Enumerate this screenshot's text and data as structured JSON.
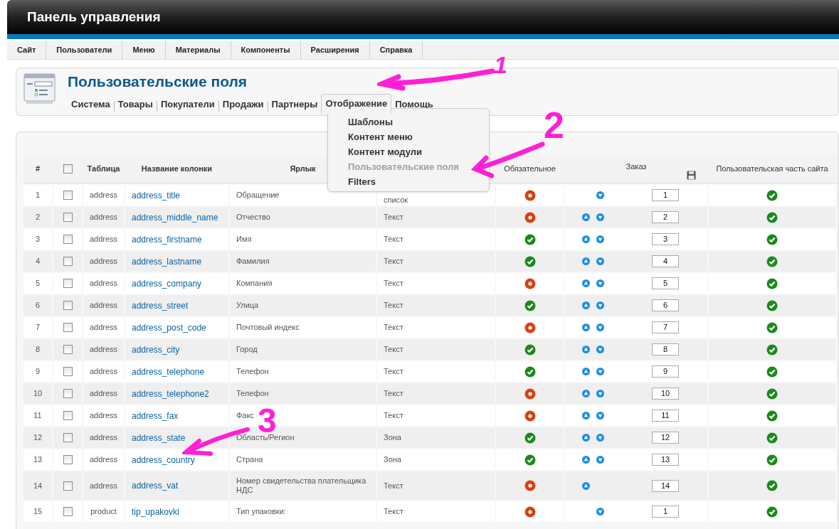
{
  "header": {
    "title": "Панель управления"
  },
  "menu": [
    {
      "label": "Сайт"
    },
    {
      "label": "Пользователи"
    },
    {
      "label": "Меню"
    },
    {
      "label": "Материалы"
    },
    {
      "label": "Компоненты"
    },
    {
      "label": "Расширения"
    },
    {
      "label": "Справка"
    }
  ],
  "page": {
    "title": "Пользовательские поля",
    "tabs": [
      {
        "label": "Система",
        "selected": false
      },
      {
        "label": "Товары",
        "selected": false
      },
      {
        "label": "Покупатели",
        "selected": false
      },
      {
        "label": "Продажи",
        "selected": false
      },
      {
        "label": "Партнеры",
        "selected": false
      },
      {
        "label": "Отображение",
        "selected": true
      },
      {
        "label": "Помощь",
        "selected": false
      }
    ]
  },
  "dropdown": {
    "items": [
      {
        "label": "Шаблоны",
        "disabled": false
      },
      {
        "label": "Контент меню",
        "disabled": false
      },
      {
        "label": "Контент модули",
        "disabled": false
      },
      {
        "label": "Пользовательские поля",
        "disabled": true
      },
      {
        "label": "Filters",
        "disabled": false
      }
    ]
  },
  "table": {
    "headers": {
      "number": "#",
      "select_all_checked": false,
      "table": "Таблица",
      "column_name": "Название колонки",
      "label": "Ярлык",
      "required": "Обязательное",
      "order": "Заказ",
      "public": "Пользовательская часть сайта"
    },
    "rows": [
      {
        "n": "1",
        "checked": false,
        "table": "address",
        "name": "address_title",
        "label": "Обращение",
        "type": "список",
        "required": false,
        "up": false,
        "down": true,
        "order": "1",
        "public": true
      },
      {
        "n": "2",
        "checked": false,
        "table": "address",
        "name": "address_middle_name",
        "label": "Отчество",
        "type": "Текст",
        "required": false,
        "up": true,
        "down": true,
        "order": "2",
        "public": true
      },
      {
        "n": "3",
        "checked": false,
        "table": "address",
        "name": "address_firstname",
        "label": "Имя",
        "type": "Текст",
        "required": true,
        "up": true,
        "down": true,
        "order": "3",
        "public": true
      },
      {
        "n": "4",
        "checked": false,
        "table": "address",
        "name": "address_lastname",
        "label": "Фамилия",
        "type": "Текст",
        "required": true,
        "up": true,
        "down": true,
        "order": "4",
        "public": true
      },
      {
        "n": "5",
        "checked": false,
        "table": "address",
        "name": "address_company",
        "label": "Компания",
        "type": "Текст",
        "required": false,
        "up": true,
        "down": true,
        "order": "5",
        "public": true
      },
      {
        "n": "6",
        "checked": false,
        "table": "address",
        "name": "address_street",
        "label": "Улица",
        "type": "Текст",
        "required": true,
        "up": true,
        "down": true,
        "order": "6",
        "public": true
      },
      {
        "n": "7",
        "checked": false,
        "table": "address",
        "name": "address_post_code",
        "label": "Почтовый индекс",
        "type": "Текст",
        "required": false,
        "up": true,
        "down": true,
        "order": "7",
        "public": true
      },
      {
        "n": "8",
        "checked": false,
        "table": "address",
        "name": "address_city",
        "label": "Город",
        "type": "Текст",
        "required": true,
        "up": true,
        "down": true,
        "order": "8",
        "public": true
      },
      {
        "n": "9",
        "checked": false,
        "table": "address",
        "name": "address_telephone",
        "label": "Телефон",
        "type": "Текст",
        "required": true,
        "up": true,
        "down": true,
        "order": "9",
        "public": true
      },
      {
        "n": "10",
        "checked": false,
        "table": "address",
        "name": "address_telephone2",
        "label": "Телефон",
        "type": "Текст",
        "required": false,
        "up": true,
        "down": true,
        "order": "10",
        "public": true
      },
      {
        "n": "11",
        "checked": false,
        "table": "address",
        "name": "address_fax",
        "label": "Факс",
        "type": "Текст",
        "required": false,
        "up": true,
        "down": true,
        "order": "11",
        "public": true
      },
      {
        "n": "12",
        "checked": false,
        "table": "address",
        "name": "address_state",
        "label": "Область/Регион",
        "type": "Зона",
        "required": true,
        "up": true,
        "down": true,
        "order": "12",
        "public": true
      },
      {
        "n": "13",
        "checked": false,
        "table": "address",
        "name": "address_country",
        "label": "Страна",
        "type": "Зона",
        "required": true,
        "up": true,
        "down": true,
        "order": "13",
        "public": true
      },
      {
        "n": "14",
        "checked": false,
        "table": "address",
        "name": "address_vat",
        "label": "Номер свидетельства плательщика НДС",
        "type": "Текст",
        "required": false,
        "up": true,
        "down": false,
        "order": "14",
        "public": true
      },
      {
        "n": "15",
        "checked": false,
        "table": "product",
        "name": "tip_upakovki",
        "label": "Тип упаковки:",
        "type": "Текст",
        "required": false,
        "up": false,
        "down": true,
        "order": "1",
        "public": true
      }
    ]
  },
  "annotations": [
    {
      "label": "1"
    },
    {
      "label": "2"
    },
    {
      "label": "3"
    }
  ]
}
